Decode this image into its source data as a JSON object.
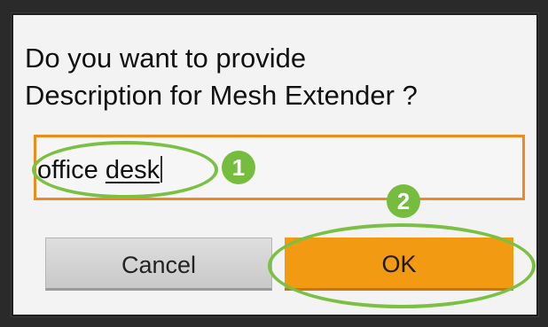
{
  "dialog": {
    "question_line1": "Do you want to provide",
    "question_line2": "Description for Mesh Extender ?",
    "input": {
      "value_plain": "office ",
      "value_underlined": "desk"
    },
    "buttons": {
      "cancel_label": "Cancel",
      "ok_label": "OK"
    }
  },
  "annotations": {
    "step1": "1",
    "step2": "2",
    "callout_color": "#7ac043"
  },
  "colors": {
    "accent_orange": "#f29a11",
    "input_border": "#ef8a1c"
  }
}
